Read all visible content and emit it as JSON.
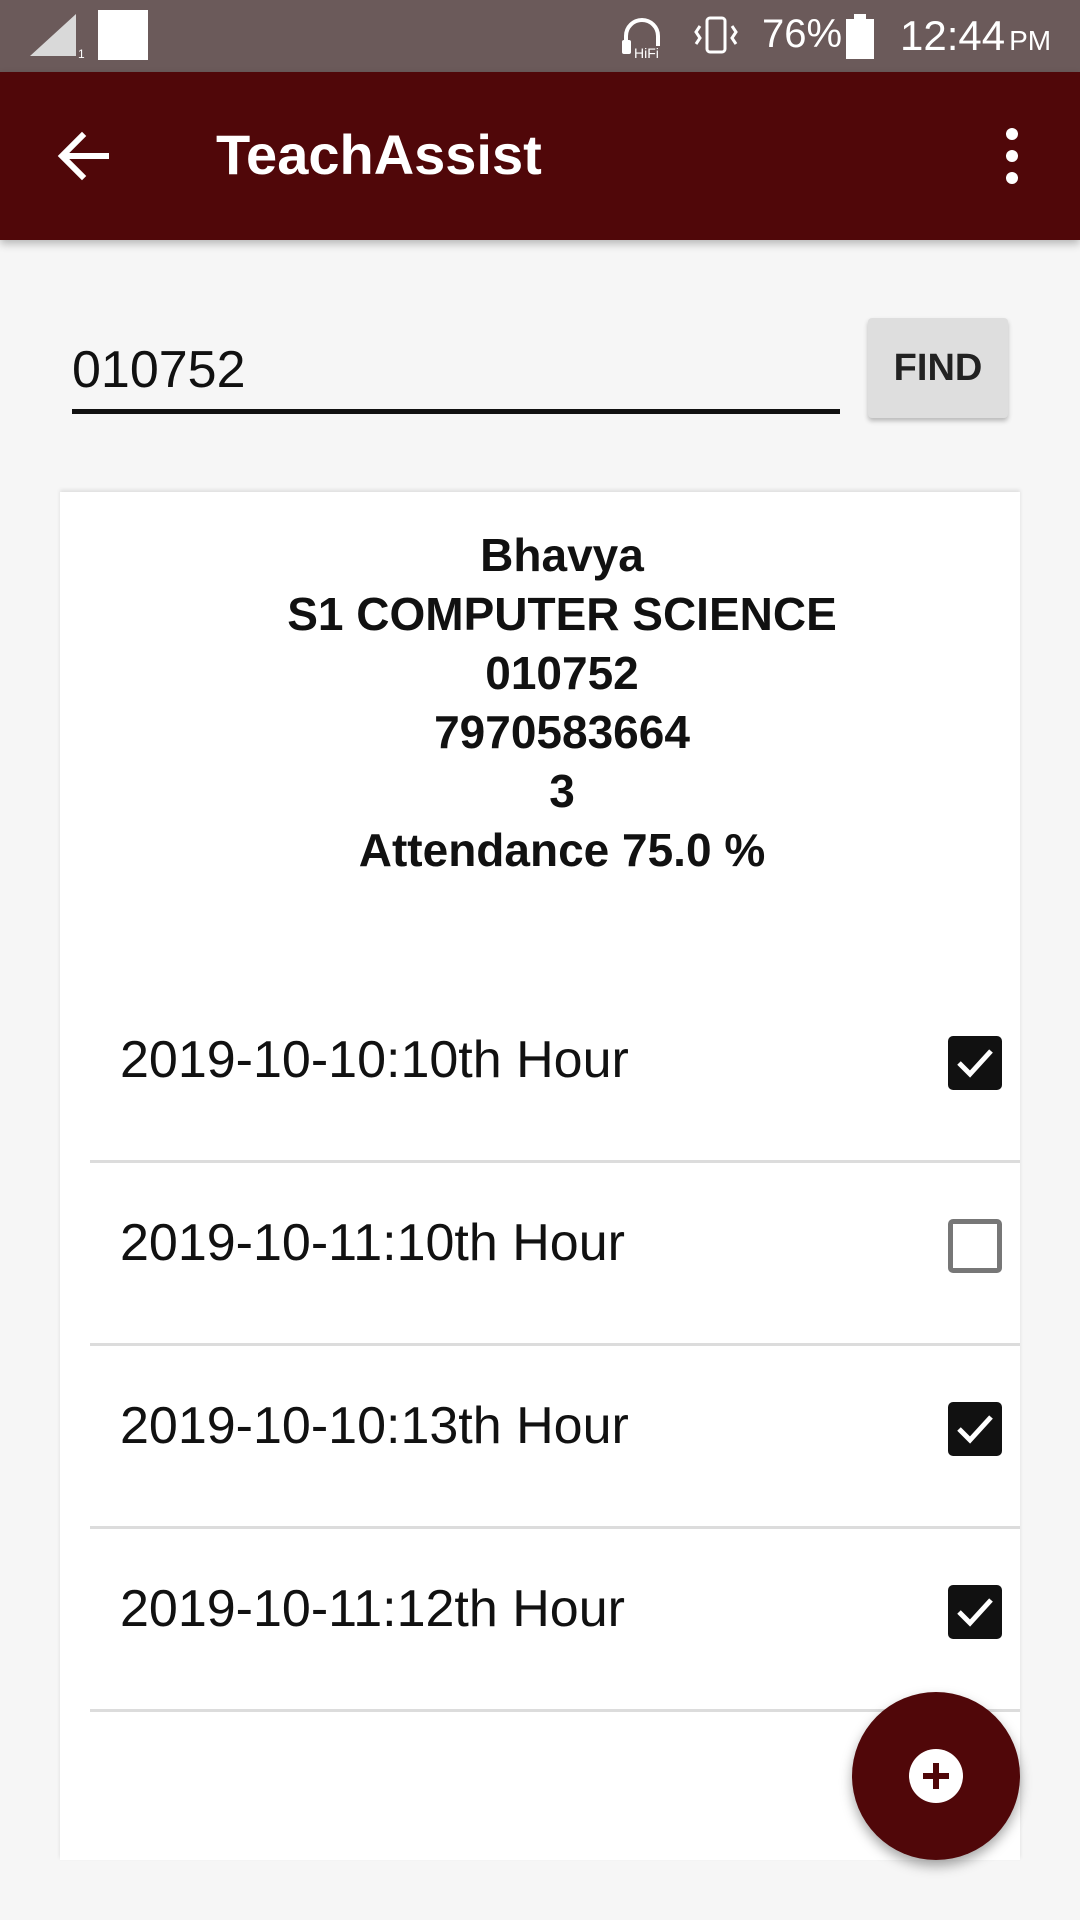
{
  "status_bar": {
    "battery": "76%",
    "time": "12:44",
    "ampm": "PM",
    "icons": [
      "signal-icon",
      "notification-icon",
      "hifi-headset-icon",
      "vibrate-icon",
      "battery-icon"
    ]
  },
  "app_bar": {
    "title": "TeachAssist",
    "back_icon": "arrow-back-icon",
    "menu_icon": "more-vert-icon"
  },
  "search": {
    "value": "010752",
    "button_label": "FIND"
  },
  "student": {
    "name": "Bhavya",
    "class": "S1 COMPUTER SCIENCE",
    "id": "010752",
    "phone": "7970583664",
    "number": "3",
    "attendance": "Attendance 75.0 %"
  },
  "attendance_records": [
    {
      "label": "2019-10-10:10th Hour",
      "checked": true
    },
    {
      "label": "2019-10-11:10th Hour",
      "checked": false
    },
    {
      "label": "2019-10-10:13th Hour",
      "checked": true
    },
    {
      "label": "2019-10-11:12th Hour",
      "checked": true
    }
  ],
  "fab": {
    "icon": "add-circle-icon"
  },
  "colors": {
    "primary": "#500709",
    "status_bar": "#6b5a5a",
    "background": "#f6f6f6"
  }
}
